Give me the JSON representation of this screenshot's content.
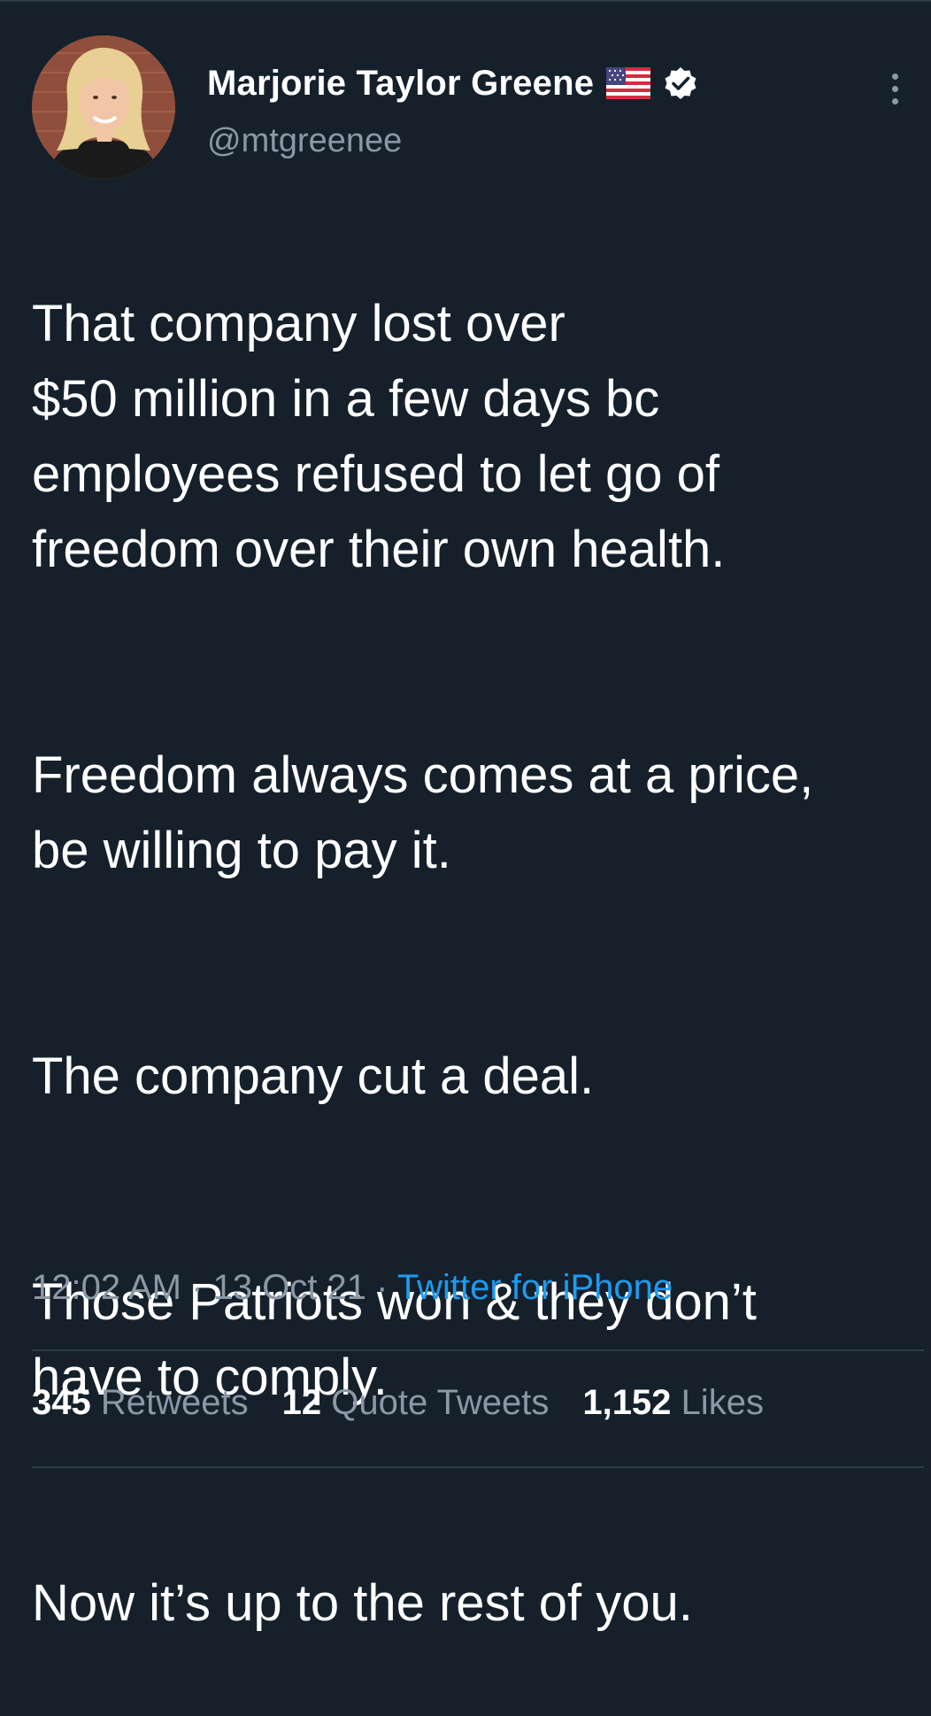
{
  "author": {
    "display_name": "Marjorie Taylor Greene",
    "handle": "@mtgreenee",
    "flag_icon": "us-flag-icon",
    "verified_icon": "verified-badge-icon"
  },
  "tweet": {
    "paragraphs": [
      "That company lost over\n$50 million in a few days bc\nemployees refused to let go of\nfreedom over their own health.",
      "Freedom always comes at a price,\nbe willing to pay it.",
      "The company cut a deal.",
      "Those Patriots won & they don’t\nhave to comply.",
      "Now it’s up to the rest of you."
    ],
    "time": "12:02 AM",
    "date": "13 Oct 21",
    "separator": "·",
    "source": "Twitter for iPhone"
  },
  "stats": {
    "retweets_count": "345",
    "retweets_label": "Retweets",
    "quotes_count": "12",
    "quotes_label": "Quote Tweets",
    "likes_count": "1,152",
    "likes_label": "Likes"
  },
  "colors": {
    "background": "#15202b",
    "text": "#ffffff",
    "secondary": "#8b98a5",
    "link": "#1d9bf0",
    "divider": "#2f3b47"
  }
}
